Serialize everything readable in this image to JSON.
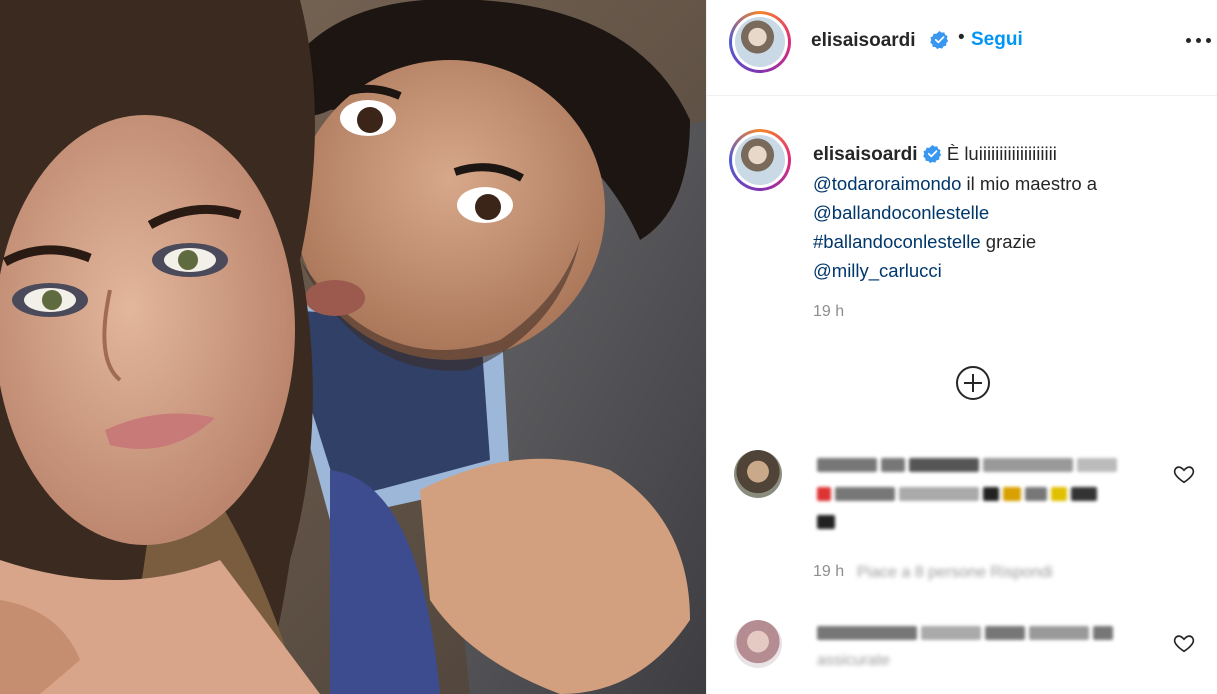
{
  "post": {
    "username": "elisaisoardi",
    "follow_label": "Segui",
    "separator": "•"
  },
  "caption": {
    "username": "elisaisoardi",
    "text_1": "È luiiiiiiiiiiiiiiiiiii",
    "mention_1": "@todaroraimondo",
    "text_2": " il mio maestro a",
    "mention_2": "@ballandoconlestelle",
    "hashtag_1": "#ballandoconlestelle",
    "text_3": " grazie",
    "mention_3": "@milly_carlucci",
    "time": "19 h"
  },
  "comments": [
    {
      "time": "19 h",
      "meta_blurred": "Piace a 8 persone Rispondi"
    },
    {
      "text_blurred": "assicurate"
    }
  ],
  "icons": {
    "verified": "verified-badge-icon",
    "more": "more-options-icon",
    "load_more": "plus-circle-icon",
    "like": "heart-icon"
  },
  "colors": {
    "accent": "#0095f6",
    "verified": "#3897f0",
    "mention": "#00376b",
    "muted": "#8e8e8e"
  }
}
